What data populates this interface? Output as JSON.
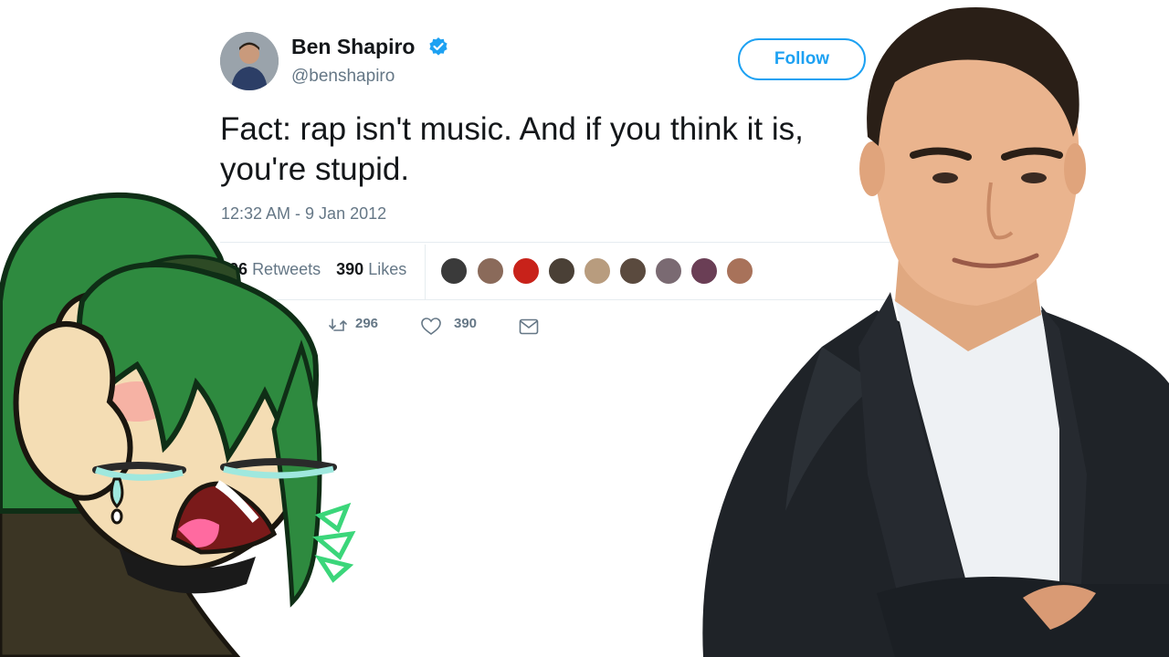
{
  "tweet": {
    "display_name": "Ben Shapiro",
    "handle": "@benshapiro",
    "follow_label": "Follow",
    "text_line1": "Fact: rap isn't music. And if you think it is,",
    "text_line2": "you're stupid.",
    "timestamp": "12:32 AM - 9 Jan 2012",
    "retweets_count": "296",
    "retweets_label": "Retweets",
    "likes_count": "390",
    "likes_label": "Likes",
    "reply_count": "296",
    "like_action_count": "390"
  },
  "colors": {
    "accent": "#1da1f2",
    "text": "#14171a",
    "muted": "#657786"
  },
  "icons": [
    "verified-badge-icon",
    "retweet-icon",
    "heart-icon",
    "envelope-icon"
  ]
}
